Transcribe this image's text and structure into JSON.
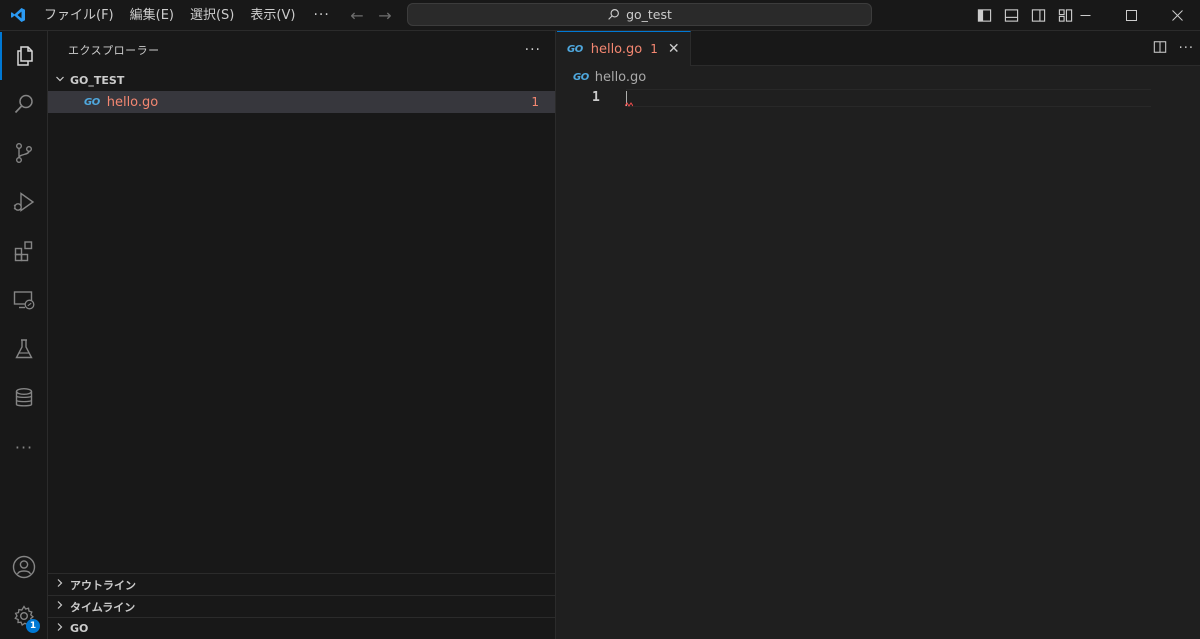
{
  "titlebar": {
    "menu": [
      "ファイル(F)",
      "編集(E)",
      "選択(S)",
      "表示(V)"
    ],
    "more": "···",
    "back_arrow": "←",
    "forward_arrow": "→",
    "search_text": "go_test"
  },
  "window_controls": {
    "minimize": "—",
    "maximize": "☐"
  },
  "activity": {
    "badge_count": "1",
    "more": "···",
    "accent_color": "#0078d4"
  },
  "sidebar": {
    "title": "エクスプローラー",
    "more": "···",
    "folder": "GO_TEST",
    "file": {
      "icon_label": "GO",
      "name": "hello.go",
      "problems": "1"
    },
    "sections": [
      "アウトライン",
      "タイムライン",
      "GO"
    ]
  },
  "editor": {
    "tab": {
      "icon_label": "GO",
      "name": "hello.go",
      "problems": "1",
      "close": "✕"
    },
    "breadcrumb": {
      "icon_label": "GO",
      "file": "hello.go"
    },
    "line_number": "1",
    "error_color": "#f48771"
  }
}
